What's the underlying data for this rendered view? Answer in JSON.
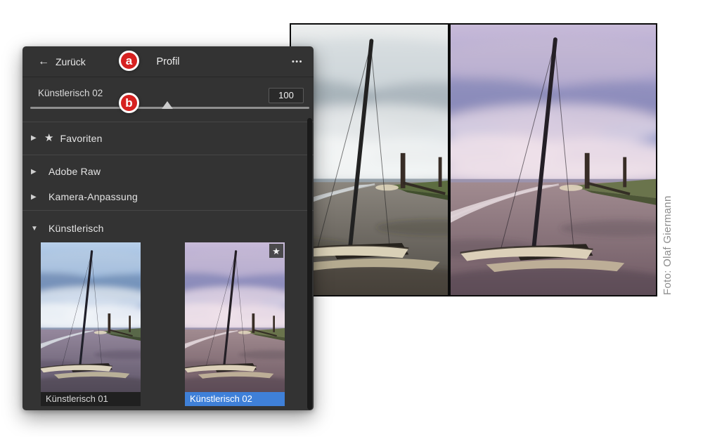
{
  "panel": {
    "header": {
      "back_icon": "←",
      "back_label": "Zurück",
      "title": "Profil",
      "menu_icon": "•••"
    },
    "amount_slider": {
      "label": "Künstlerisch 02",
      "value": "100",
      "position_pct": 49
    },
    "sections": [
      {
        "disclosure": "▶",
        "icon": "★",
        "label": "Favoriten",
        "expanded": false
      },
      {
        "disclosure": "▶",
        "label": "Adobe Raw",
        "expanded": false
      },
      {
        "disclosure": "▶",
        "label": "Kamera-Anpassung",
        "expanded": false
      },
      {
        "disclosure": "▼",
        "label": "Künstlerisch",
        "expanded": true
      }
    ],
    "profiles": [
      {
        "label": "Künstlerisch 01",
        "selected": false
      },
      {
        "label": "Künstlerisch 02",
        "selected": true,
        "favorite_icon": "★"
      }
    ]
  },
  "annotations": [
    {
      "letter": "a"
    },
    {
      "letter": "b"
    }
  ],
  "photo_credit": "Foto: Olaf Giermann",
  "colors": {
    "panel_bg": "#333333",
    "selection_blue": "#3f80d8",
    "annotation_red": "#d62120",
    "label_bar_dark": "#202020",
    "slider_track": "#8f8f8f",
    "scrollbar": "#1a1a1a"
  },
  "scene_palettes": {
    "natural": {
      "skyTop": "#eceeee",
      "skyMid": "#c6cfd4",
      "skyHorizon": "#b0bac1",
      "cloudLight": "#f2f4f4",
      "cloudMid": "#ccd5d9",
      "cloudDark": "#93a0a9",
      "cloudAccent": "#b4c3cc",
      "distant": "#98a3ab",
      "mudTop": "#8b867e",
      "mudBottom": "#4f4b45",
      "mudShadow": "#343029",
      "water": "#cfd4d6",
      "grass": "#5c6c40",
      "grassDark": "#414f2e",
      "hull": "#d9d0b7",
      "hullShade": "#b5ab90",
      "rig": "#222222"
    },
    "artistic01": {
      "skyTop": "#b9d0ea",
      "skyMid": "#7ba1d2",
      "skyHorizon": "#a3b1cf",
      "cloudLight": "#eff3f8",
      "cloudMid": "#bccde2",
      "cloudDark": "#7086a8",
      "cloudAccent": "#5e86c0",
      "distant": "#8f9bb4",
      "mudTop": "#95889d",
      "mudBottom": "#5e5568",
      "mudShadow": "#3b3542",
      "water": "#d5d9e0",
      "grass": "#596849",
      "grassDark": "#3f4c32",
      "hull": "#ddd4be",
      "hullShade": "#b9b098",
      "rig": "#20202a"
    },
    "artistic02": {
      "skyTop": "#c9bbd9",
      "skyMid": "#9a97c7",
      "skyHorizon": "#b5a9c6",
      "cloudLight": "#eee0e9",
      "cloudMid": "#c6b9d4",
      "cloudDark": "#8184b2",
      "cloudAccent": "#7f93cb",
      "distant": "#9c94ae",
      "mudTop": "#a18b90",
      "mudBottom": "#6d5862",
      "mudShadow": "#463943",
      "water": "#e0d4d8",
      "grass": "#6a744c",
      "grassDark": "#4c5536",
      "hull": "#dcd0b9",
      "hullShade": "#bdae97",
      "rig": "#241f26"
    }
  }
}
